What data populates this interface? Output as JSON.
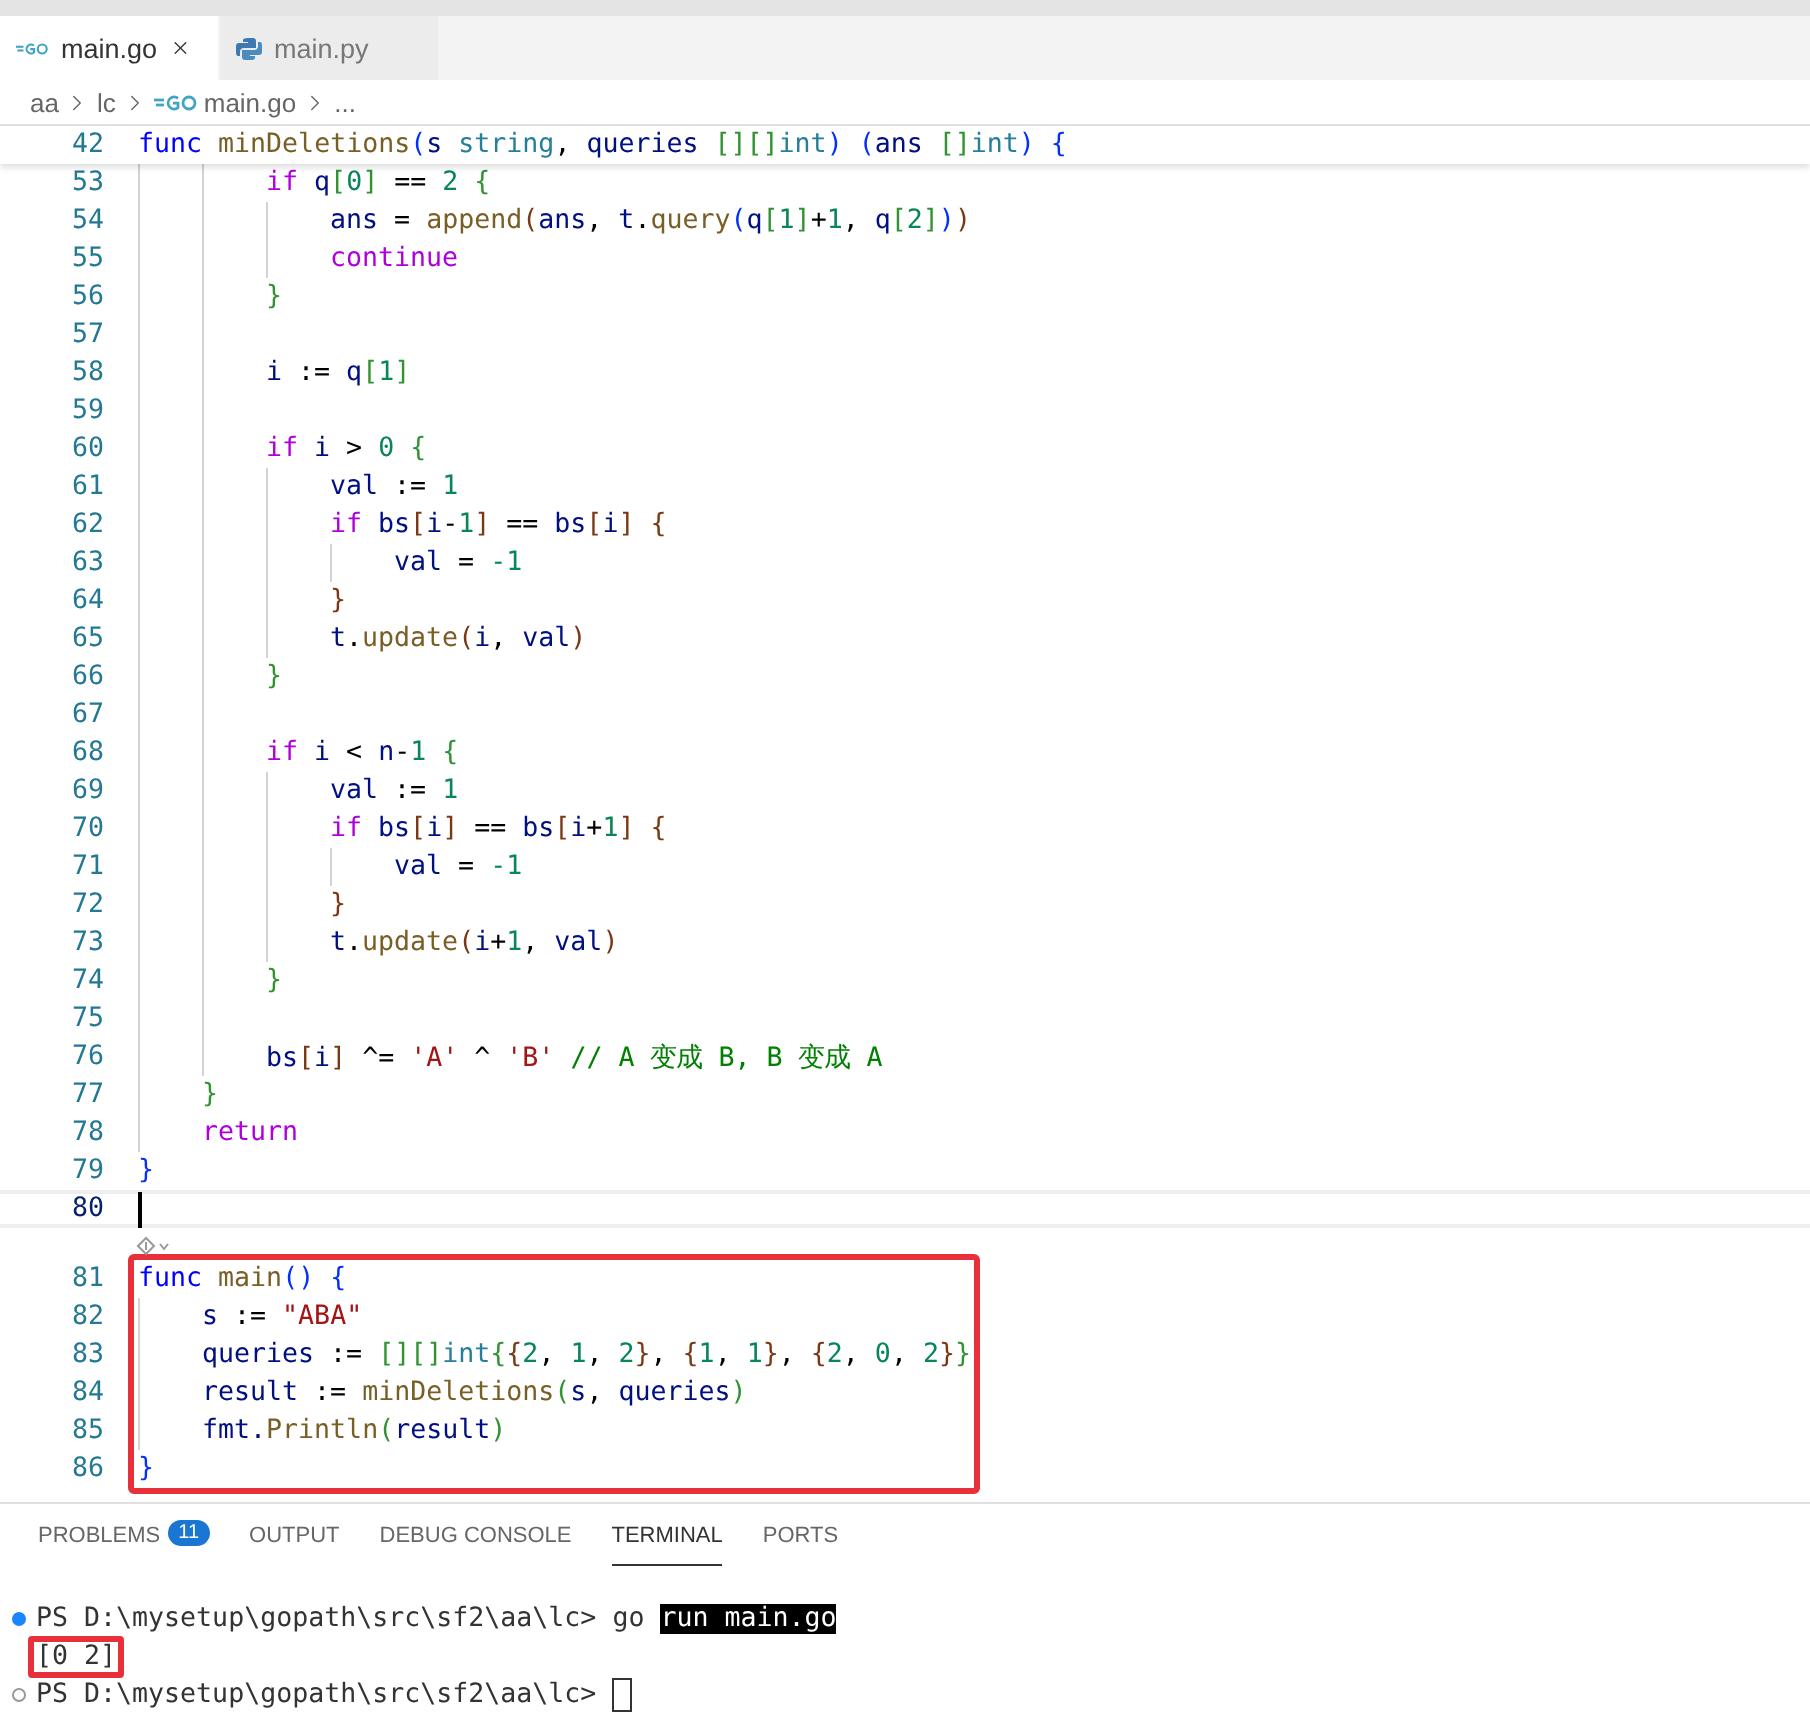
{
  "tabs": [
    {
      "label": "main.go",
      "kind": "go",
      "selected": true,
      "closable": true
    },
    {
      "label": "main.py",
      "kind": "python",
      "selected": false,
      "closable": false
    }
  ],
  "breadcrumb": [
    {
      "label": "aa",
      "kind": "folder"
    },
    {
      "label": "lc",
      "kind": "folder"
    },
    {
      "label": "main.go",
      "kind": "go"
    },
    {
      "label": "...",
      "kind": "more"
    }
  ],
  "editor": {
    "sticky": {
      "number": "42",
      "tokens": [
        {
          "kind": "k",
          "text": "func "
        },
        {
          "kind": "f",
          "text": "minDeletions"
        },
        {
          "kind": "b1",
          "text": "("
        },
        {
          "kind": "v",
          "text": "s "
        },
        {
          "kind": "t",
          "text": "string"
        },
        {
          "kind": "p",
          "text": ", "
        },
        {
          "kind": "v",
          "text": "queries "
        },
        {
          "kind": "b2",
          "text": "[][]"
        },
        {
          "kind": "t",
          "text": "int"
        },
        {
          "kind": "b1",
          "text": ") ("
        },
        {
          "kind": "v",
          "text": "ans "
        },
        {
          "kind": "b2",
          "text": "[]"
        },
        {
          "kind": "t",
          "text": "int"
        },
        {
          "kind": "b1",
          "text": ") {"
        }
      ]
    },
    "blocks": [
      {
        "highlighted": false,
        "lines": [
          {
            "number": "53",
            "current": false,
            "tokens": [
              {
                "kind": "c",
                "text": "        if "
              },
              {
                "kind": "v",
                "text": "q"
              },
              {
                "kind": "b2",
                "text": "["
              },
              {
                "kind": "n",
                "text": "0"
              },
              {
                "kind": "b2",
                "text": "]"
              },
              {
                "kind": "p",
                "text": " == "
              },
              {
                "kind": "n",
                "text": "2"
              },
              {
                "kind": "b2",
                "text": " {"
              }
            ]
          },
          {
            "number": "54",
            "current": false,
            "tokens": [
              {
                "kind": "v",
                "text": "            ans"
              },
              {
                "kind": "p",
                "text": " = "
              },
              {
                "kind": "f",
                "text": "append"
              },
              {
                "kind": "b3",
                "text": "("
              },
              {
                "kind": "v",
                "text": "ans"
              },
              {
                "kind": "p",
                "text": ", "
              },
              {
                "kind": "v",
                "text": "t"
              },
              {
                "kind": "p",
                "text": "."
              },
              {
                "kind": "f",
                "text": "query"
              },
              {
                "kind": "b1",
                "text": "("
              },
              {
                "kind": "v",
                "text": "q"
              },
              {
                "kind": "b2",
                "text": "["
              },
              {
                "kind": "n",
                "text": "1"
              },
              {
                "kind": "b2",
                "text": "]"
              },
              {
                "kind": "p",
                "text": "+"
              },
              {
                "kind": "n",
                "text": "1"
              },
              {
                "kind": "p",
                "text": ", "
              },
              {
                "kind": "v",
                "text": "q"
              },
              {
                "kind": "b2",
                "text": "["
              },
              {
                "kind": "n",
                "text": "2"
              },
              {
                "kind": "b2",
                "text": "]"
              },
              {
                "kind": "b1",
                "text": ")"
              },
              {
                "kind": "b3",
                "text": ")"
              }
            ]
          },
          {
            "number": "55",
            "current": false,
            "tokens": [
              {
                "kind": "c",
                "text": "            continue"
              }
            ]
          },
          {
            "number": "56",
            "current": false,
            "tokens": [
              {
                "kind": "b2",
                "text": "        }"
              }
            ]
          },
          {
            "number": "57",
            "current": false
          },
          {
            "number": "58",
            "current": false,
            "tokens": [
              {
                "kind": "v",
                "text": "        i"
              },
              {
                "kind": "p",
                "text": " := "
              },
              {
                "kind": "v",
                "text": "q"
              },
              {
                "kind": "b2",
                "text": "["
              },
              {
                "kind": "n",
                "text": "1"
              },
              {
                "kind": "b2",
                "text": "]"
              }
            ]
          },
          {
            "number": "59",
            "current": false
          },
          {
            "number": "60",
            "current": false,
            "tokens": [
              {
                "kind": "c",
                "text": "        if "
              },
              {
                "kind": "v",
                "text": "i"
              },
              {
                "kind": "p",
                "text": " > "
              },
              {
                "kind": "n",
                "text": "0"
              },
              {
                "kind": "b2",
                "text": " {"
              }
            ]
          },
          {
            "number": "61",
            "current": false,
            "tokens": [
              {
                "kind": "v",
                "text": "            val"
              },
              {
                "kind": "p",
                "text": " := "
              },
              {
                "kind": "n",
                "text": "1"
              }
            ]
          },
          {
            "number": "62",
            "current": false,
            "tokens": [
              {
                "kind": "c",
                "text": "            if "
              },
              {
                "kind": "v",
                "text": "bs"
              },
              {
                "kind": "b3",
                "text": "["
              },
              {
                "kind": "v",
                "text": "i"
              },
              {
                "kind": "p",
                "text": "-"
              },
              {
                "kind": "n",
                "text": "1"
              },
              {
                "kind": "b3",
                "text": "]"
              },
              {
                "kind": "p",
                "text": " == "
              },
              {
                "kind": "v",
                "text": "bs"
              },
              {
                "kind": "b3",
                "text": "["
              },
              {
                "kind": "v",
                "text": "i"
              },
              {
                "kind": "b3",
                "text": "] {"
              }
            ]
          },
          {
            "number": "63",
            "current": false,
            "tokens": [
              {
                "kind": "v",
                "text": "                val"
              },
              {
                "kind": "p",
                "text": " = "
              },
              {
                "kind": "n",
                "text": "-1"
              }
            ]
          },
          {
            "number": "64",
            "current": false,
            "tokens": [
              {
                "kind": "b3",
                "text": "            }"
              }
            ]
          },
          {
            "number": "65",
            "current": false,
            "tokens": [
              {
                "kind": "v",
                "text": "            t"
              },
              {
                "kind": "p",
                "text": "."
              },
              {
                "kind": "f",
                "text": "update"
              },
              {
                "kind": "b3",
                "text": "("
              },
              {
                "kind": "v",
                "text": "i"
              },
              {
                "kind": "p",
                "text": ", "
              },
              {
                "kind": "v",
                "text": "val"
              },
              {
                "kind": "b3",
                "text": ")"
              }
            ]
          },
          {
            "number": "66",
            "current": false,
            "tokens": [
              {
                "kind": "b2",
                "text": "        }"
              }
            ]
          },
          {
            "number": "67",
            "current": false
          },
          {
            "number": "68",
            "current": false,
            "tokens": [
              {
                "kind": "c",
                "text": "        if "
              },
              {
                "kind": "v",
                "text": "i"
              },
              {
                "kind": "p",
                "text": " < "
              },
              {
                "kind": "v",
                "text": "n"
              },
              {
                "kind": "p",
                "text": "-"
              },
              {
                "kind": "n",
                "text": "1"
              },
              {
                "kind": "b2",
                "text": " {"
              }
            ]
          },
          {
            "number": "69",
            "current": false,
            "tokens": [
              {
                "kind": "v",
                "text": "            val"
              },
              {
                "kind": "p",
                "text": " := "
              },
              {
                "kind": "n",
                "text": "1"
              }
            ]
          },
          {
            "number": "70",
            "current": false,
            "tokens": [
              {
                "kind": "c",
                "text": "            if "
              },
              {
                "kind": "v",
                "text": "bs"
              },
              {
                "kind": "b3",
                "text": "["
              },
              {
                "kind": "v",
                "text": "i"
              },
              {
                "kind": "b3",
                "text": "]"
              },
              {
                "kind": "p",
                "text": " == "
              },
              {
                "kind": "v",
                "text": "bs"
              },
              {
                "kind": "b3",
                "text": "["
              },
              {
                "kind": "v",
                "text": "i"
              },
              {
                "kind": "p",
                "text": "+"
              },
              {
                "kind": "n",
                "text": "1"
              },
              {
                "kind": "b3",
                "text": "] {"
              }
            ]
          },
          {
            "number": "71",
            "current": false,
            "tokens": [
              {
                "kind": "v",
                "text": "                val"
              },
              {
                "kind": "p",
                "text": " = "
              },
              {
                "kind": "n",
                "text": "-1"
              }
            ]
          },
          {
            "number": "72",
            "current": false,
            "tokens": [
              {
                "kind": "b3",
                "text": "            }"
              }
            ]
          },
          {
            "number": "73",
            "current": false,
            "tokens": [
              {
                "kind": "v",
                "text": "            t"
              },
              {
                "kind": "p",
                "text": "."
              },
              {
                "kind": "f",
                "text": "update"
              },
              {
                "kind": "b3",
                "text": "("
              },
              {
                "kind": "v",
                "text": "i"
              },
              {
                "kind": "p",
                "text": "+"
              },
              {
                "kind": "n",
                "text": "1"
              },
              {
                "kind": "p",
                "text": ", "
              },
              {
                "kind": "v",
                "text": "val"
              },
              {
                "kind": "b3",
                "text": ")"
              }
            ]
          },
          {
            "number": "74",
            "current": false,
            "tokens": [
              {
                "kind": "b2",
                "text": "        }"
              }
            ]
          },
          {
            "number": "75",
            "current": false
          },
          {
            "number": "76",
            "current": false,
            "tokens": [
              {
                "kind": "v",
                "text": "        bs"
              },
              {
                "kind": "b3",
                "text": "["
              },
              {
                "kind": "v",
                "text": "i"
              },
              {
                "kind": "b3",
                "text": "]"
              },
              {
                "kind": "p",
                "text": " ^= "
              },
              {
                "kind": "s",
                "text": "'A'"
              },
              {
                "kind": "p",
                "text": " ^ "
              },
              {
                "kind": "s",
                "text": "'B' "
              },
              {
                "kind": "m",
                "text": "// A 变成 B, B 变成 A"
              }
            ]
          },
          {
            "number": "77",
            "current": false,
            "tokens": [
              {
                "kind": "b2",
                "text": "    }"
              }
            ]
          },
          {
            "number": "78",
            "current": false,
            "tokens": [
              {
                "kind": "c",
                "text": "    return"
              }
            ]
          },
          {
            "number": "79",
            "current": false,
            "tokens": [
              {
                "kind": "b1",
                "text": "}"
              }
            ]
          },
          {
            "number": "80",
            "current": true
          }
        ]
      },
      {
        "highlighted": true,
        "lines": [
          {
            "number": "81",
            "current": false,
            "tokens": [
              {
                "kind": "k",
                "text": "func "
              },
              {
                "kind": "f",
                "text": "main"
              },
              {
                "kind": "b1",
                "text": "() {"
              }
            ]
          },
          {
            "number": "82",
            "current": false,
            "tokens": [
              {
                "kind": "v",
                "text": "    s"
              },
              {
                "kind": "p",
                "text": " := "
              },
              {
                "kind": "s",
                "text": "\"ABA\""
              }
            ]
          },
          {
            "number": "83",
            "current": false,
            "tokens": [
              {
                "kind": "v",
                "text": "    queries"
              },
              {
                "kind": "p",
                "text": " := "
              },
              {
                "kind": "b2",
                "text": "[][]"
              },
              {
                "kind": "t",
                "text": "int"
              },
              {
                "kind": "b2",
                "text": "{"
              },
              {
                "kind": "b3",
                "text": "{"
              },
              {
                "kind": "n",
                "text": "2"
              },
              {
                "kind": "p",
                "text": ", "
              },
              {
                "kind": "n",
                "text": "1"
              },
              {
                "kind": "p",
                "text": ", "
              },
              {
                "kind": "n",
                "text": "2"
              },
              {
                "kind": "b3",
                "text": "}"
              },
              {
                "kind": "p",
                "text": ", "
              },
              {
                "kind": "b3",
                "text": "{"
              },
              {
                "kind": "n",
                "text": "1"
              },
              {
                "kind": "p",
                "text": ", "
              },
              {
                "kind": "n",
                "text": "1"
              },
              {
                "kind": "b3",
                "text": "}"
              },
              {
                "kind": "p",
                "text": ", "
              },
              {
                "kind": "b3",
                "text": "{"
              },
              {
                "kind": "n",
                "text": "2"
              },
              {
                "kind": "p",
                "text": ", "
              },
              {
                "kind": "n",
                "text": "0"
              },
              {
                "kind": "p",
                "text": ", "
              },
              {
                "kind": "n",
                "text": "2"
              },
              {
                "kind": "b3",
                "text": "}"
              },
              {
                "kind": "b2",
                "text": "}"
              }
            ]
          },
          {
            "number": "84",
            "current": false,
            "tokens": [
              {
                "kind": "v",
                "text": "    result"
              },
              {
                "kind": "p",
                "text": " := "
              },
              {
                "kind": "f",
                "text": "minDeletions"
              },
              {
                "kind": "b2",
                "text": "("
              },
              {
                "kind": "v",
                "text": "s"
              },
              {
                "kind": "p",
                "text": ", "
              },
              {
                "kind": "v",
                "text": "queries"
              },
              {
                "kind": "b2",
                "text": ")"
              }
            ]
          },
          {
            "number": "85",
            "current": false,
            "tokens": [
              {
                "kind": "v",
                "text": "    fmt."
              },
              {
                "kind": "f",
                "text": "Println"
              },
              {
                "kind": "b2",
                "text": "("
              },
              {
                "kind": "v",
                "text": "result"
              },
              {
                "kind": "b2",
                "text": ")"
              }
            ]
          },
          {
            "number": "86",
            "current": false,
            "tokens": [
              {
                "kind": "b1",
                "text": "}"
              }
            ]
          }
        ]
      }
    ]
  },
  "panel": {
    "tabs": [
      {
        "label": "PROBLEMS",
        "badge": "11",
        "selected": false
      },
      {
        "label": "OUTPUT",
        "selected": false
      },
      {
        "label": "DEBUG CONSOLE",
        "selected": false
      },
      {
        "label": "TERMINAL",
        "selected": true
      },
      {
        "label": "PORTS",
        "selected": false
      }
    ],
    "terminal": [
      {
        "kind": "command",
        "decoration": true,
        "success": true,
        "highlighted": false,
        "parts": [
          {
            "text": "PS D:\\mysetup\\gopath\\src\\sf2\\aa\\lc>",
            "selected": false
          },
          {
            "text": "go",
            "selected": false
          },
          {
            "text": "run main.go",
            "selected": true
          }
        ]
      },
      {
        "kind": "output",
        "decoration": false,
        "highlighted": true,
        "parts": [
          {
            "text": "[0 2]",
            "selected": false
          }
        ]
      },
      {
        "kind": "prompt",
        "decoration": true,
        "success": false,
        "highlighted": false,
        "parts": [
          {
            "text": "PS D:\\mysetup\\gopath\\src\\sf2\\aa\\lc>",
            "selected": false
          }
        ]
      }
    ]
  }
}
